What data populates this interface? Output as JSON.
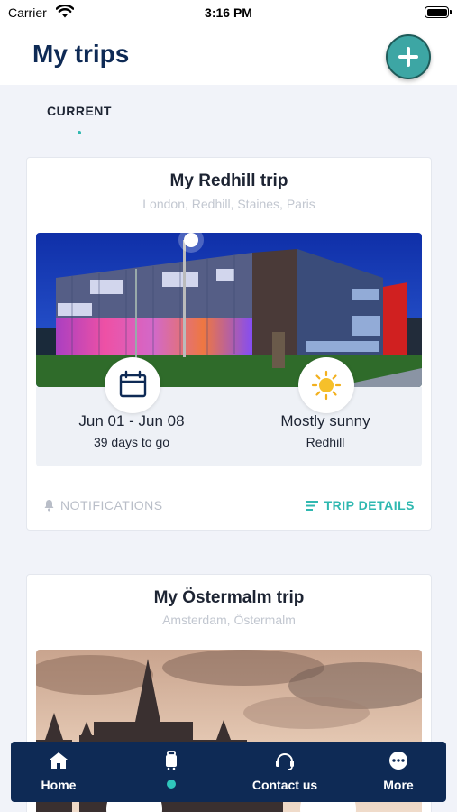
{
  "status_bar": {
    "carrier": "Carrier",
    "time": "3:16 PM"
  },
  "header": {
    "title": "My trips"
  },
  "tabs": {
    "current": "CURRENT"
  },
  "trips": [
    {
      "title": "My Redhill trip",
      "locations": "London, Redhill, Staines, Paris",
      "dates": "Jun 01 - Jun 08",
      "countdown": "39 days to go",
      "weather": "Mostly sunny",
      "weather_location": "Redhill",
      "notifications_label": "NOTIFICATIONS",
      "details_label": "TRIP DETAILS"
    },
    {
      "title": "My Östermalm trip",
      "locations": "Amsterdam, Östermalm"
    }
  ],
  "tab_bar": {
    "home": "Home",
    "contact": "Contact us",
    "more": "More"
  },
  "colors": {
    "navy": "#0e2a55",
    "accent": "#2fb8b0",
    "add_button": "#3da6a4"
  },
  "icons": [
    "wifi-icon",
    "battery-icon",
    "plus-icon",
    "calendar-icon",
    "sun-icon",
    "bell-icon",
    "list-icon",
    "home-icon",
    "luggage-icon",
    "headset-icon",
    "more-icon"
  ]
}
